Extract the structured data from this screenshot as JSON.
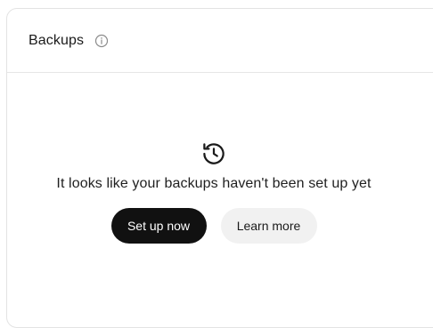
{
  "card": {
    "title": "Backups",
    "info_icon": "info-icon"
  },
  "empty_state": {
    "icon": "history-icon",
    "message": "It looks like your backups haven't been set up yet"
  },
  "actions": {
    "primary_label": "Set up now",
    "secondary_label": "Learn more"
  },
  "colors": {
    "primary_button_bg": "#111111",
    "secondary_button_bg": "#f1f1f1",
    "border": "#e3e3e3"
  }
}
